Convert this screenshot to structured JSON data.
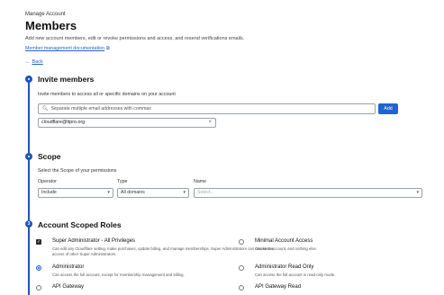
{
  "header": {
    "eyebrow": "Manage Account",
    "title": "Members",
    "subtitle": "Add new account members, edit or revoke permissions and access, and resend verifications emails.",
    "doc_link": "Member management documentation",
    "back": "Back"
  },
  "invite": {
    "title": "Invite members",
    "hint": "Invite members to access all or specific domains on your account",
    "placeholder": "Separate multiple email addresses with commas",
    "add_label": "Add",
    "chip": "cloudflare@ttpro.org"
  },
  "scope": {
    "title": "Scope",
    "hint": "Select the Scope of your permissions",
    "operator_label": "Operator",
    "type_label": "Type",
    "name_label": "Name",
    "operator_value": "Include",
    "type_value": "All domains",
    "name_placeholder": "Select..."
  },
  "roles": {
    "step_number": "3",
    "title": "Account Scoped Roles",
    "left": [
      {
        "name": "Super Administrator - All Privileges",
        "desc": "Can edit any Cloudflare setting, make purchases, update billing, and manage memberships. Super Administrators can revoke the access of other Super Administrators.",
        "state": "checked"
      },
      {
        "name": "Administrator",
        "desc": "Can access the full account, except for membership management and billing.",
        "state": "selected"
      },
      {
        "name": "API Gateway",
        "desc": "",
        "state": "off"
      }
    ],
    "right": [
      {
        "name": "Minimal Account Access",
        "desc": "Can view account, and nothing else.",
        "state": "off"
      },
      {
        "name": "Administrator Read Only",
        "desc": "Can access the full account in read-only mode.",
        "state": "off"
      },
      {
        "name": "API Gateway Read",
        "desc": "",
        "state": "off"
      }
    ]
  }
}
